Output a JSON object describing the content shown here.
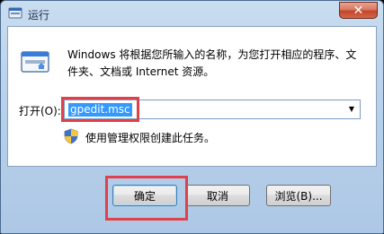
{
  "window": {
    "title": "运行",
    "close_symbol": "✕",
    "title_icon": "run-icon",
    "close_icon": "close-icon"
  },
  "content": {
    "app_icon": "run-dialog-icon",
    "description": "Windows 将根据您所输入的名称，为您打开相应的程序、文件夹、文档或 Internet 资源。",
    "open_label": "打开(O):",
    "command_value": "gpedit.msc",
    "dropdown_icon": "chevron-down-icon",
    "admin_icon": "uac-shield-icon",
    "admin_note": "使用管理权限创建此任务。"
  },
  "buttons": {
    "ok": "确定",
    "cancel": "取消",
    "browse": "浏览(B)..."
  },
  "colors": {
    "selection": "#3399ff",
    "highlight_box": "#e0404a",
    "window_frame": "#b9d1ea"
  }
}
